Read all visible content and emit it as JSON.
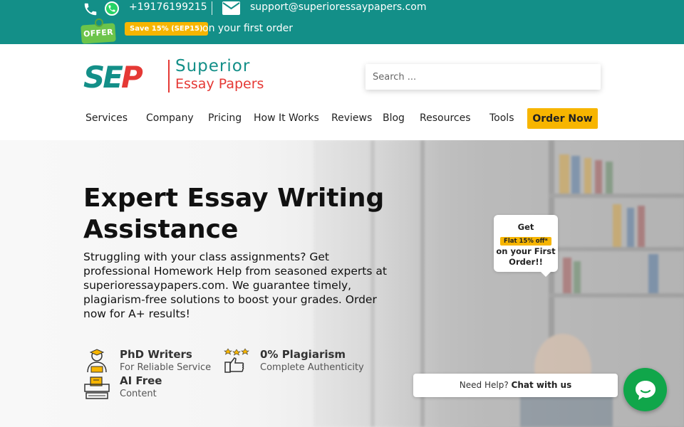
{
  "topbar": {
    "phone": "+19176199215",
    "email": "support@superioressaypapers.com",
    "offer_label": "OFFER",
    "save_badge": "Save 15% (SEP15)",
    "first_order_text": "on your first order"
  },
  "header": {
    "logo": {
      "mark": "SEP",
      "line1": "Superior",
      "line2": "Essay Papers"
    },
    "search": {
      "placeholder": "Search ..."
    },
    "nav": [
      "Services",
      "Company",
      "Pricing",
      "How It Works",
      "Reviews",
      "Blog",
      "Resources",
      "Tools"
    ],
    "order_button": "Order Now"
  },
  "hero": {
    "title": "Expert Essay Writing Assistance",
    "description": "Struggling with your class assignments? Get professional Homework Help from seasoned experts at superioressaypapers.com. We guarantee timely, plagiarism-free solutions to boost your grades. Order now for A+ results!",
    "features": [
      {
        "title": "PhD Writers",
        "subtitle": "For Reliable Service",
        "icon": "phd-writer-icon"
      },
      {
        "title": "0% Plagiarism",
        "subtitle": "Complete Authenticity",
        "icon": "thumbs-up-stars-icon"
      },
      {
        "title": "AI Free",
        "subtitle": "Content",
        "icon": "ai-free-icon"
      }
    ]
  },
  "promo": {
    "get": "Get",
    "badge": "Flat 15% off*",
    "line1": "on your First",
    "line2": "Order!!"
  },
  "chat": {
    "prefix": "Need Help?",
    "cta": "Chat with us"
  },
  "colors": {
    "brand_teal": "#138f88",
    "brand_red": "#e53935",
    "accent_yellow": "#f7b500",
    "chat_green": "#10a64a"
  }
}
